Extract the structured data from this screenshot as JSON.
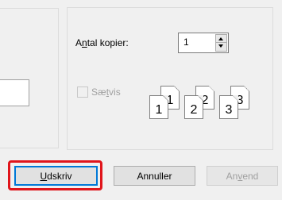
{
  "copies": {
    "label_before": "A",
    "label_access": "n",
    "label_after": "tal kopier:",
    "value": "1"
  },
  "collate": {
    "label_before": "Sæ",
    "label_access": "t",
    "label_after": "vis",
    "checked": false,
    "enabled": false
  },
  "collate_preview": {
    "stacks": [
      {
        "front": "1",
        "back": "1"
      },
      {
        "front": "2",
        "back": "2"
      },
      {
        "front": "3",
        "back": "3"
      }
    ]
  },
  "buttons": {
    "print": {
      "access": "U",
      "rest": "dskriv"
    },
    "cancel": {
      "label": "Annuller"
    },
    "apply": {
      "before": "An",
      "access": "v",
      "after": "end",
      "enabled": false
    }
  },
  "highlight_color": "#e0151b"
}
